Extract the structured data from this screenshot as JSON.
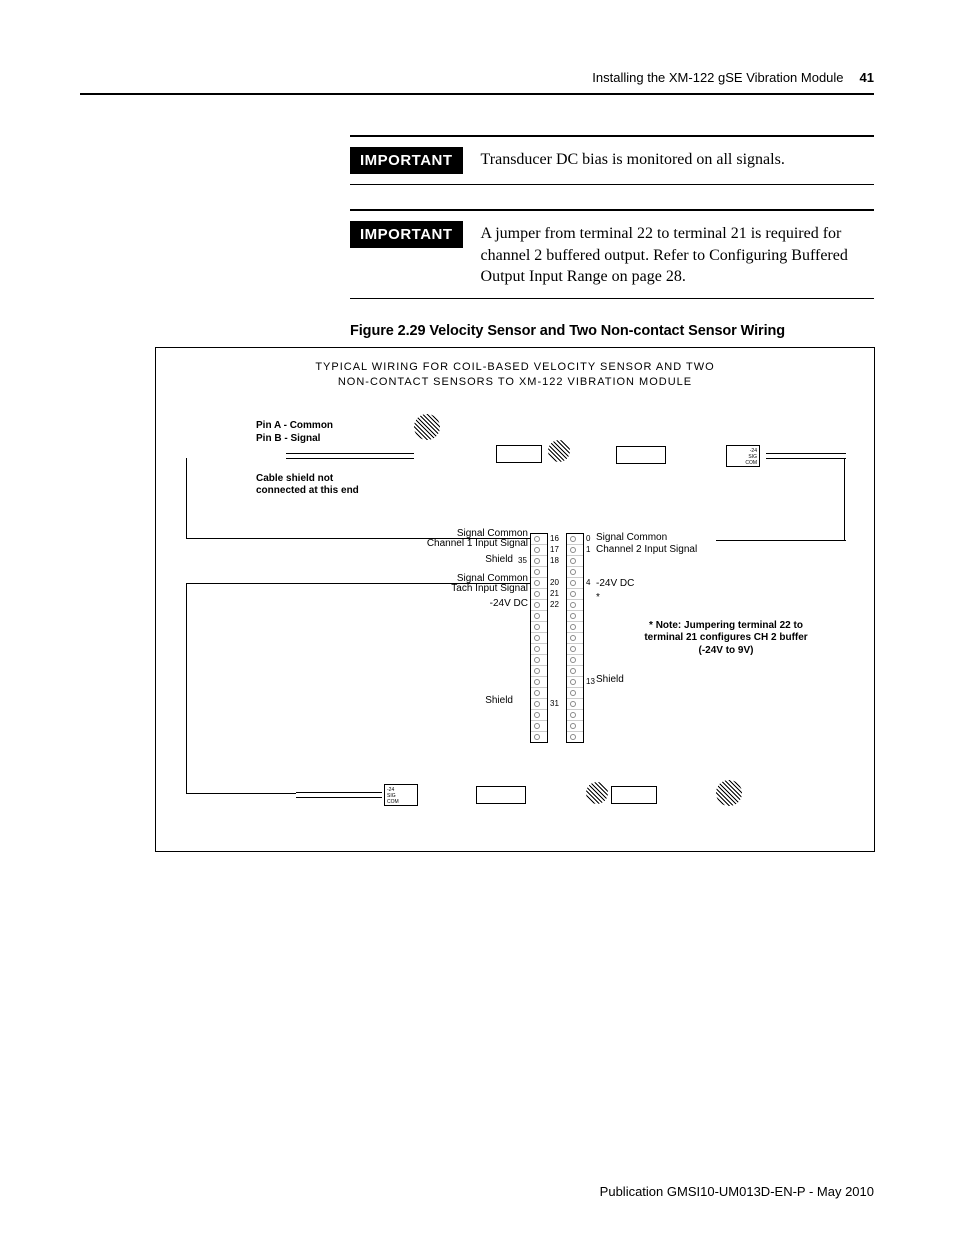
{
  "header": {
    "chapter_title": "Installing the XM-122 gSE Vibration Module",
    "page_number": "41"
  },
  "callouts": [
    {
      "badge": "IMPORTANT",
      "text": "Transducer DC bias is monitored on all signals."
    },
    {
      "badge": "IMPORTANT",
      "text": "A jumper from terminal 22 to terminal 21 is required for channel 2 buffered output. Refer to Configuring Buffered Output Input Range on page 28."
    }
  ],
  "figure": {
    "title": "Figure 2.29 Velocity Sensor and Two Non-contact Sensor Wiring",
    "diagram_title_line1": "TYPICAL WIRING FOR COIL-BASED VELOCITY SENSOR AND TWO",
    "diagram_title_line2": "NON-CONTACT SENSORS TO XM-122 VIBRATION MODULE",
    "labels": {
      "pin_a": "Pin A - Common",
      "pin_b": "Pin B - Signal",
      "shield_note": "Cable shield not connected at this end",
      "sig_common_l1": "Signal Common",
      "ch1_input": "Channel 1 Input Signal",
      "shield_l": "Shield",
      "sig_common_l2": "Signal Common",
      "tach_input": "Tach Input Signal",
      "neg24_l": "-24V DC",
      "shield_l2": "Shield",
      "sig_common_r": "Signal Common",
      "ch2_input": "Channel 2 Input Signal",
      "neg24_r": "-24V DC",
      "star": "*",
      "shield_r": "Shield",
      "note": "* Note: Jumpering terminal 22 to terminal 21 configures CH 2 buffer (-24V to 9V)",
      "amp_l1": "-24",
      "amp_l2": "SIG",
      "amp_l3": "COM"
    },
    "terminals": {
      "t16": "16",
      "t17": "17",
      "t35": "35",
      "t18": "18",
      "t20": "20",
      "t21": "21",
      "t22": "22",
      "t0": "0",
      "t1": "1",
      "t4": "4",
      "t13": "13",
      "t31": "31"
    }
  },
  "footer": {
    "pubref": "Publication GMSI10-UM013D-EN-P - May 2010"
  }
}
